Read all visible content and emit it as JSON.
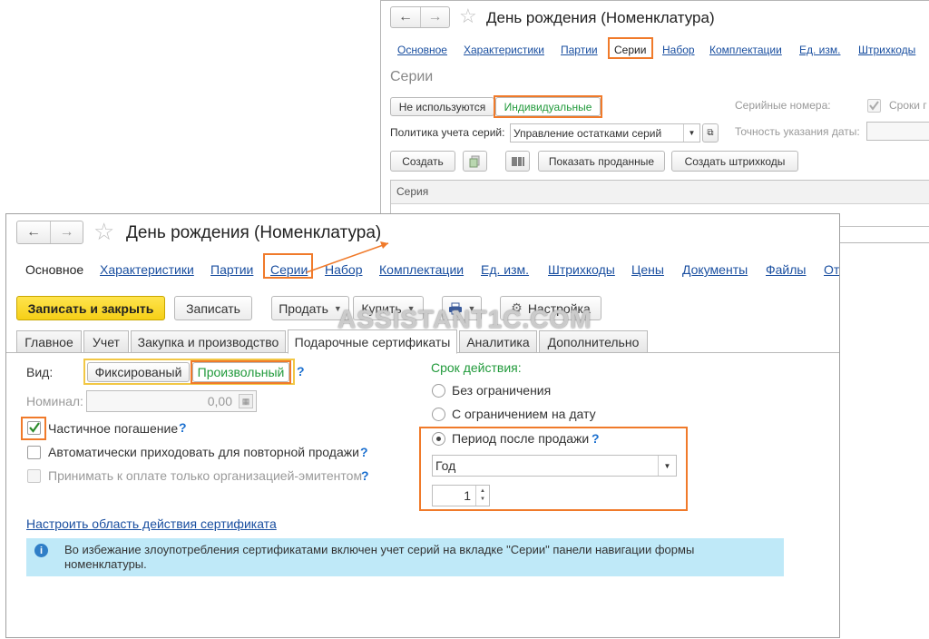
{
  "watermark": "ASSISTANT1C.COM",
  "accent_color": "#f07a2a",
  "series_window": {
    "title": "День рождения (Номенклатура)",
    "nav_links": [
      "Основное",
      "Характеристики",
      "Партии",
      "Серии",
      "Набор",
      "Комплектации",
      "Ед. изм.",
      "Штрихкоды"
    ],
    "section_title": "Серии",
    "usage_buttons": [
      "Не используются",
      "Индивидуальные"
    ],
    "serial_numbers_label": "Серийные номера:",
    "expiry_label": "Сроки г",
    "policy_label": "Политика учета серий:",
    "policy_value": "Управление остатками серий",
    "date_precision_label": "Точность указания даты:",
    "buttons": {
      "create": "Создать",
      "show_sold": "Показать проданные",
      "create_barcodes": "Создать штрихкоды"
    },
    "table_header": "Серия"
  },
  "main_window": {
    "title": "День рождения (Номенклатура)",
    "nav_links": [
      "Основное",
      "Характеристики",
      "Партии",
      "Серии",
      "Набор",
      "Комплектации",
      "Ед. изм.",
      "Штрихкоды",
      "Цены",
      "Документы",
      "Файлы",
      "От"
    ],
    "toolbar": {
      "save_close": "Записать и закрыть",
      "save": "Записать",
      "sell": "Продать",
      "buy": "Купить",
      "settings": "Настройка"
    },
    "tabs": [
      "Главное",
      "Учет",
      "Закупка и производство",
      "Подарочные сертификаты",
      "Аналитика",
      "Дополнительно"
    ],
    "form": {
      "kind_label": "Вид:",
      "kind_options": [
        "Фиксированый",
        "Произвольный"
      ],
      "help": "?",
      "nominal_label": "Номинал:",
      "nominal_value": "0,00",
      "partial_redemption": "Частичное погашение",
      "auto_receive": "Автоматически приходовать для повторной продажи",
      "issuer_only": "Принимать к оплате только организацией-эмитентом",
      "scope_link": "Настроить область действия сертификата",
      "validity_label": "Срок действия:",
      "validity_options": [
        "Без ограничения",
        "С ограничением на дату",
        "Период после продажи"
      ],
      "period_unit": "Год",
      "period_count": "1",
      "info_text": "Во избежание злоупотребления сертификатами включен учет серий на вкладке \"Серии\" панели навигации формы номенклатуры."
    }
  }
}
